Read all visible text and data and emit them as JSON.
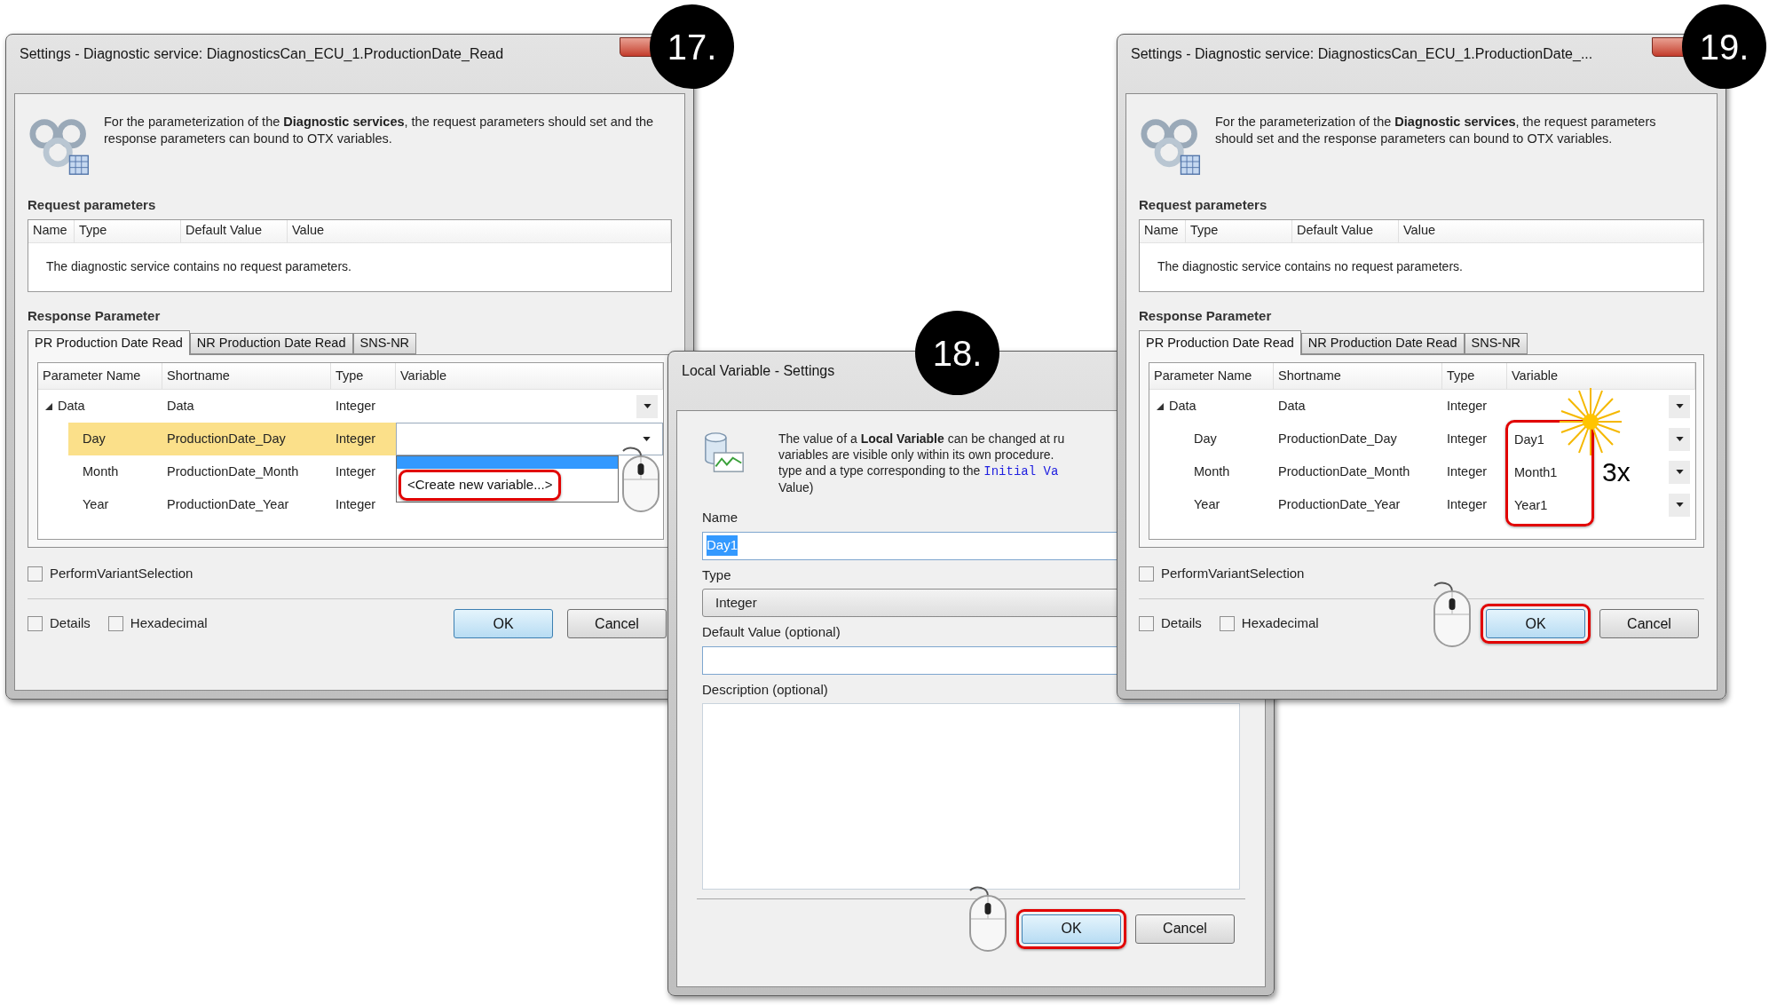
{
  "dialogs": [
    {
      "kind": "service",
      "badge": "17.",
      "title": "Settings - Diagnostic service: DiagnosticsCan_ECU_1.ProductionDate_Read",
      "intro": "For the parameterization of the **Diagnostic services**, the request parameters should set and the response parameters can bound to OTX variables.",
      "request": {
        "heading": "Request parameters",
        "columns": [
          "Name",
          "Type",
          "Default Value",
          "Value"
        ],
        "message": "The diagnostic service contains no request parameters."
      },
      "response": {
        "heading": "Response Parameter",
        "tabs": [
          {
            "label": "PR Production Date Read",
            "selected": true
          },
          {
            "label": "NR Production Date Read",
            "selected": false
          },
          {
            "label": "SNS-NR",
            "selected": false
          }
        ],
        "columns": [
          "Parameter Name",
          "Shortname",
          "Type",
          "Variable"
        ],
        "rows": [
          {
            "name": "Data",
            "shortname": "Data",
            "type": "Integer",
            "expanded": true,
            "selected": false,
            "children": [
              {
                "name": "Day",
                "shortname": "ProductionDate_Day",
                "type": "Integer",
                "selected": true,
                "popup": {
                  "option": "<Create new variable...>",
                  "highlighted": true
                }
              },
              {
                "name": "Month",
                "shortname": "ProductionDate_Month",
                "type": "Integer",
                "selected": false
              },
              {
                "name": "Year",
                "shortname": "ProductionDate_Year",
                "type": "Integer",
                "selected": false
              }
            ]
          }
        ],
        "variables_highlighted": false
      },
      "options": [
        {
          "label": "PerformVariantSelection",
          "checked": false
        }
      ],
      "footer_options": [
        {
          "label": "Details",
          "checked": false
        },
        {
          "label": "Hexadecimal",
          "checked": false
        }
      ],
      "buttons": [
        {
          "label": "OK",
          "default": true,
          "highlighted": false
        },
        {
          "label": "Cancel",
          "default": false,
          "highlighted": false
        }
      ]
    },
    {
      "kind": "variable",
      "badge": "18.",
      "title": "Local Variable - Settings",
      "intro_lines": [
        {
          "text": "The value of a **Local Variable** can be changed at ru"
        },
        {
          "text": "variables are visible only within its own procedure."
        },
        {
          "text": "type and a type corresponding to the",
          "code": "Initial Va"
        },
        {
          "text": "Value)"
        }
      ],
      "fields": [
        {
          "kind": "text",
          "label": "Name",
          "value": "Day1",
          "selected": true
        },
        {
          "kind": "combo",
          "label": "Type",
          "value": "Integer"
        },
        {
          "kind": "text",
          "label": "Default Value (optional)"
        },
        {
          "kind": "area",
          "label": "Description (optional)"
        }
      ],
      "buttons": [
        {
          "label": "OK",
          "default": true,
          "highlighted": true
        },
        {
          "label": "Cancel",
          "default": false,
          "highlighted": false
        }
      ]
    },
    {
      "kind": "service",
      "badge": "19.",
      "title": "Settings - Diagnostic service: DiagnosticsCan_ECU_1.ProductionDate_...",
      "intro": "For the parameterization of the **Diagnostic services**, the request parameters should set and the response parameters can bound to OTX variables.",
      "request": {
        "heading": "Request parameters",
        "columns": [
          "Name",
          "Type",
          "Default Value",
          "Value"
        ],
        "message": "The diagnostic service contains no request parameters."
      },
      "response": {
        "heading": "Response Parameter",
        "tabs": [
          {
            "label": "PR Production Date Read",
            "selected": true
          },
          {
            "label": "NR Production Date Read",
            "selected": false
          },
          {
            "label": "SNS-NR",
            "selected": false
          }
        ],
        "columns": [
          "Parameter Name",
          "Shortname",
          "Type",
          "Variable"
        ],
        "rows": [
          {
            "name": "Data",
            "shortname": "Data",
            "type": "Integer",
            "expanded": true,
            "selected": false,
            "children": [
              {
                "name": "Day",
                "shortname": "ProductionDate_Day",
                "type": "Integer",
                "variable": "Day1",
                "selected": false
              },
              {
                "name": "Month",
                "shortname": "ProductionDate_Month",
                "type": "Integer",
                "variable": "Month1",
                "selected": false
              },
              {
                "name": "Year",
                "shortname": "ProductionDate_Year",
                "type": "Integer",
                "variable": "Year1",
                "selected": false
              }
            ]
          }
        ],
        "variables_highlighted": true,
        "callout": "3x"
      },
      "options": [
        {
          "label": "PerformVariantSelection",
          "checked": false
        }
      ],
      "footer_options": [
        {
          "label": "Details",
          "checked": false
        },
        {
          "label": "Hexadecimal",
          "checked": false
        }
      ],
      "buttons": [
        {
          "label": "OK",
          "default": true,
          "highlighted": true
        },
        {
          "label": "Cancel",
          "default": false,
          "highlighted": false
        }
      ]
    }
  ]
}
